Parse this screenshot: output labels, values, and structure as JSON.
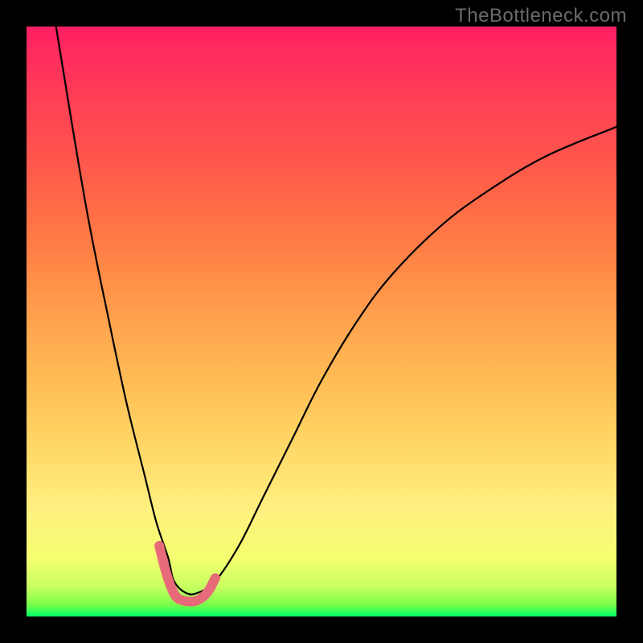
{
  "watermark": "TheBottleneck.com",
  "chart_data": {
    "type": "line",
    "title": "",
    "xlabel": "",
    "ylabel": "",
    "xlim": [
      0,
      100
    ],
    "ylim": [
      0,
      100
    ],
    "series": [
      {
        "name": "black-curve",
        "color": "#000000",
        "x": [
          5,
          10,
          14,
          17,
          20,
          22,
          24,
          25,
          27,
          29,
          32,
          36,
          40,
          45,
          50,
          56,
          62,
          70,
          78,
          88,
          100
        ],
        "values": [
          100,
          70,
          50,
          36,
          24,
          16,
          10,
          6,
          4,
          4,
          6,
          12,
          20,
          30,
          40,
          50,
          58,
          66,
          72,
          78,
          83
        ]
      },
      {
        "name": "pink-highlight",
        "color": "#e76a78",
        "x": [
          22.5,
          23.5,
          24.5,
          25.5,
          27.0,
          28.5,
          30.0,
          31.0,
          32.0
        ],
        "values": [
          12.0,
          8.0,
          5.0,
          3.2,
          2.6,
          2.6,
          3.4,
          4.6,
          6.5
        ]
      }
    ]
  }
}
